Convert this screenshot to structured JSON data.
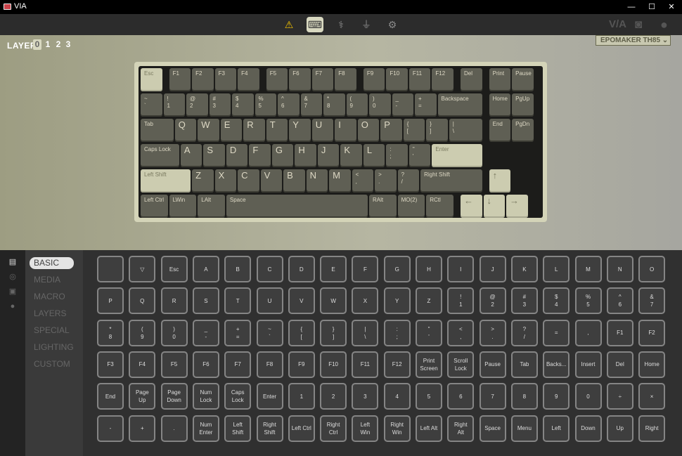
{
  "titlebar": {
    "title": "VIA",
    "minimize": "—",
    "maximize": "☐",
    "close": "✕"
  },
  "topbar": {
    "icons": [
      {
        "name": "warning",
        "glyph": "⚠"
      },
      {
        "name": "keyboard",
        "glyph": "⌨"
      },
      {
        "name": "stethoscope",
        "glyph": "⚕"
      },
      {
        "name": "plug",
        "glyph": "⏚"
      },
      {
        "name": "gear",
        "glyph": "⚙"
      }
    ],
    "brand": "V/A",
    "discord": "◙",
    "github": "●"
  },
  "layers": {
    "label": "LAYER",
    "items": [
      "0",
      "1",
      "2",
      "3"
    ],
    "active": 0
  },
  "device": {
    "name": "EPOMAKER TH85 ⌄"
  },
  "keyboard": {
    "rows": [
      [
        {
          "l": "Esc",
          "w": 1,
          "light": true
        },
        {
          "gap": 0.25
        },
        {
          "l": "F1"
        },
        {
          "l": "F2"
        },
        {
          "l": "F3"
        },
        {
          "l": "F4"
        },
        {
          "gap": 0.25
        },
        {
          "l": "F5"
        },
        {
          "l": "F6"
        },
        {
          "l": "F7"
        },
        {
          "l": "F8"
        },
        {
          "gap": 0.25
        },
        {
          "l": "F9"
        },
        {
          "l": "F10"
        },
        {
          "l": "F11"
        },
        {
          "l": "F12"
        },
        {
          "gap": 0.25
        },
        {
          "l": "Del"
        },
        {
          "gap": 0.25
        },
        {
          "l": "Print"
        },
        {
          "l": "Pause"
        }
      ],
      [
        {
          "l": "~\n`"
        },
        {
          "l": "!\n1"
        },
        {
          "l": "@\n2"
        },
        {
          "l": "#\n3"
        },
        {
          "l": "$\n4"
        },
        {
          "l": "%\n5"
        },
        {
          "l": "^\n6"
        },
        {
          "l": "&\n7"
        },
        {
          "l": "*\n8"
        },
        {
          "l": "(\n9"
        },
        {
          "l": ")\n0"
        },
        {
          "l": "_\n-"
        },
        {
          "l": "+\n="
        },
        {
          "l": "Backspace",
          "w": 2
        },
        {
          "gap": 0.25
        },
        {
          "l": "Home"
        },
        {
          "l": "PgUp"
        }
      ],
      [
        {
          "l": "Tab",
          "w": 1.5
        },
        {
          "l": "Q",
          "big": true
        },
        {
          "l": "W",
          "big": true
        },
        {
          "l": "E",
          "big": true
        },
        {
          "l": "R",
          "big": true
        },
        {
          "l": "T",
          "big": true
        },
        {
          "l": "Y",
          "big": true
        },
        {
          "l": "U",
          "big": true
        },
        {
          "l": "I",
          "big": true
        },
        {
          "l": "O",
          "big": true
        },
        {
          "l": "P",
          "big": true
        },
        {
          "l": "{\n["
        },
        {
          "l": "}\n]"
        },
        {
          "l": "|\n\\",
          "w": 1.5
        },
        {
          "gap": 0.25
        },
        {
          "l": "End"
        },
        {
          "l": "PgDn"
        }
      ],
      [
        {
          "l": "Caps Lock",
          "w": 1.75
        },
        {
          "l": "A",
          "big": true
        },
        {
          "l": "S",
          "big": true
        },
        {
          "l": "D",
          "big": true
        },
        {
          "l": "F",
          "big": true
        },
        {
          "l": "G",
          "big": true
        },
        {
          "l": "H",
          "big": true
        },
        {
          "l": "J",
          "big": true
        },
        {
          "l": "K",
          "big": true
        },
        {
          "l": "L",
          "big": true
        },
        {
          "l": ":\n;"
        },
        {
          "l": "\"\n'"
        },
        {
          "l": "Enter",
          "w": 2.25,
          "light": true
        }
      ],
      [
        {
          "l": "Left Shift",
          "w": 2.25,
          "light": true
        },
        {
          "l": "Z",
          "big": true
        },
        {
          "l": "X",
          "big": true
        },
        {
          "l": "C",
          "big": true
        },
        {
          "l": "V",
          "big": true
        },
        {
          "l": "B",
          "big": true
        },
        {
          "l": "N",
          "big": true
        },
        {
          "l": "M",
          "big": true
        },
        {
          "l": "<\n,"
        },
        {
          "l": ">\n."
        },
        {
          "l": "?\n/"
        },
        {
          "l": "Right Shift",
          "w": 2.75
        },
        {
          "gap": 0.25
        },
        {
          "l": "↑",
          "light": true,
          "big": true
        }
      ],
      [
        {
          "l": "Left Ctrl",
          "w": 1.25
        },
        {
          "l": "LWin",
          "w": 1.25
        },
        {
          "l": "LAlt",
          "w": 1.25
        },
        {
          "l": "Space",
          "w": 6.25
        },
        {
          "l": "RAlt",
          "w": 1.25
        },
        {
          "l": "MO(2)",
          "w": 1.25
        },
        {
          "l": "RCtl",
          "w": 1.25
        },
        {
          "gap": 0.25
        },
        {
          "l": "←",
          "light": true,
          "big": true
        },
        {
          "l": "↓",
          "light": true,
          "big": true
        },
        {
          "l": "→",
          "light": true,
          "big": true
        }
      ]
    ]
  },
  "categories": {
    "items": [
      "BASIC",
      "MEDIA",
      "MACRO",
      "LAYERS",
      "SPECIAL",
      "LIGHTING",
      "CUSTOM"
    ],
    "active": 0
  },
  "sidebar_icons": [
    "keyboard",
    "radio",
    "save",
    "bulb"
  ],
  "keycodes": [
    [
      "",
      "▽",
      "Esc",
      "A",
      "B",
      "C",
      "D",
      "E",
      "F",
      "G",
      "H",
      "I",
      "J",
      "K",
      "L",
      "M",
      "N",
      "O"
    ],
    [
      "P",
      "Q",
      "R",
      "S",
      "T",
      "U",
      "V",
      "W",
      "X",
      "Y",
      "Z",
      "!\n1",
      "@\n2",
      "#\n3",
      "$\n4",
      "%\n5",
      "^\n6",
      "&\n7"
    ],
    [
      "*\n8",
      "(\n9",
      ")\n0",
      "_\n-",
      "+\n=",
      "~\n`",
      "{\n[",
      "}\n]",
      "|\n\\",
      ":\n;",
      "\"\n'",
      "<\n,",
      ">\n.",
      "?\n/",
      "=",
      ",",
      "F1",
      "F2"
    ],
    [
      "F3",
      "F4",
      "F5",
      "F6",
      "F7",
      "F8",
      "F9",
      "F10",
      "F11",
      "F12",
      "Print\nScreen",
      "Scroll\nLock",
      "Pause",
      "Tab",
      "Backs...",
      "Insert",
      "Del",
      "Home"
    ],
    [
      "End",
      "Page\nUp",
      "Page\nDown",
      "Num\nLock",
      "Caps\nLock",
      "Enter",
      "1",
      "2",
      "3",
      "4",
      "5",
      "6",
      "7",
      "8",
      "9",
      "0",
      "÷",
      "×"
    ],
    [
      "-",
      "+",
      ".",
      "Num\nEnter",
      "Left\nShift",
      "Right\nShift",
      "Left Ctrl",
      "Right\nCtrl",
      "Left\nWin",
      "Right\nWin",
      "Left Alt",
      "Right\nAlt",
      "Space",
      "Menu",
      "Left",
      "Down",
      "Up",
      "Right"
    ]
  ]
}
